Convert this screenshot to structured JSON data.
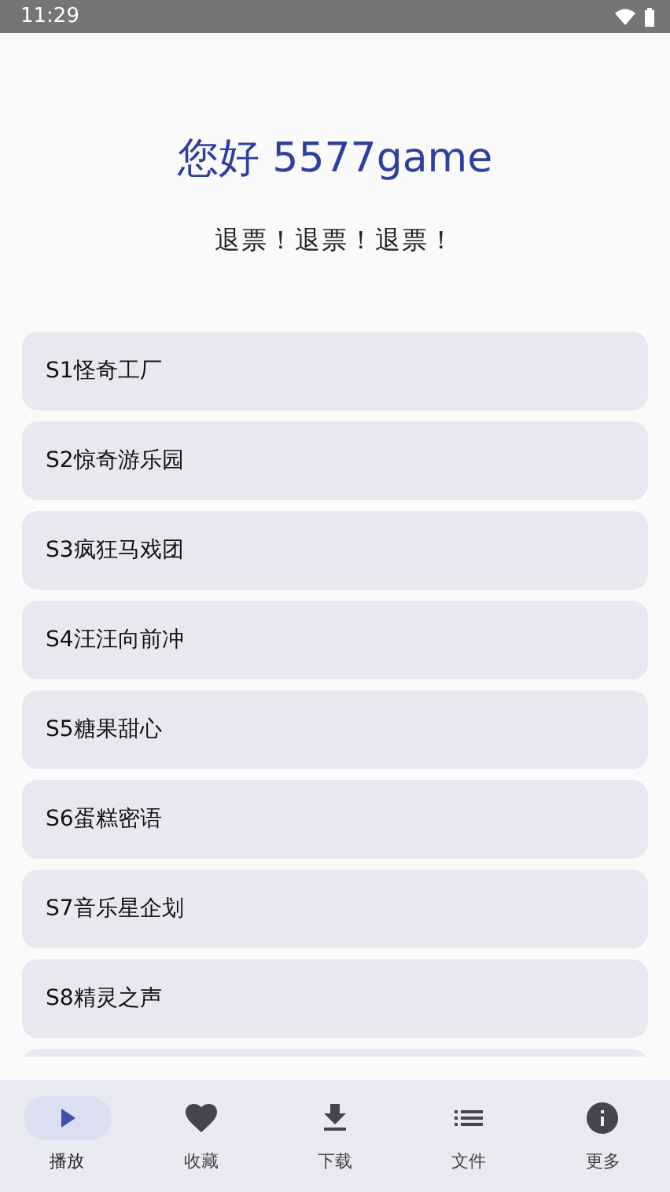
{
  "status_bar": {
    "time": "11:29"
  },
  "greeting": "您好 5577game",
  "subtitle": "退票！退票！退票！",
  "seasons": [
    {
      "label": "S1怪奇工厂"
    },
    {
      "label": "S2惊奇游乐园"
    },
    {
      "label": "S3疯狂马戏团"
    },
    {
      "label": "S4汪汪向前冲"
    },
    {
      "label": "S5糖果甜心"
    },
    {
      "label": "S6蛋糕密语"
    },
    {
      "label": "S7音乐星企划"
    },
    {
      "label": "S8精灵之声"
    }
  ],
  "bottom_nav": [
    {
      "kind": "play",
      "label": "播放",
      "selected": true
    },
    {
      "kind": "heart",
      "label": "收藏",
      "selected": false
    },
    {
      "kind": "download",
      "label": "下载",
      "selected": false
    },
    {
      "kind": "list",
      "label": "文件",
      "selected": false
    },
    {
      "kind": "info",
      "label": "更多",
      "selected": false
    }
  ]
}
